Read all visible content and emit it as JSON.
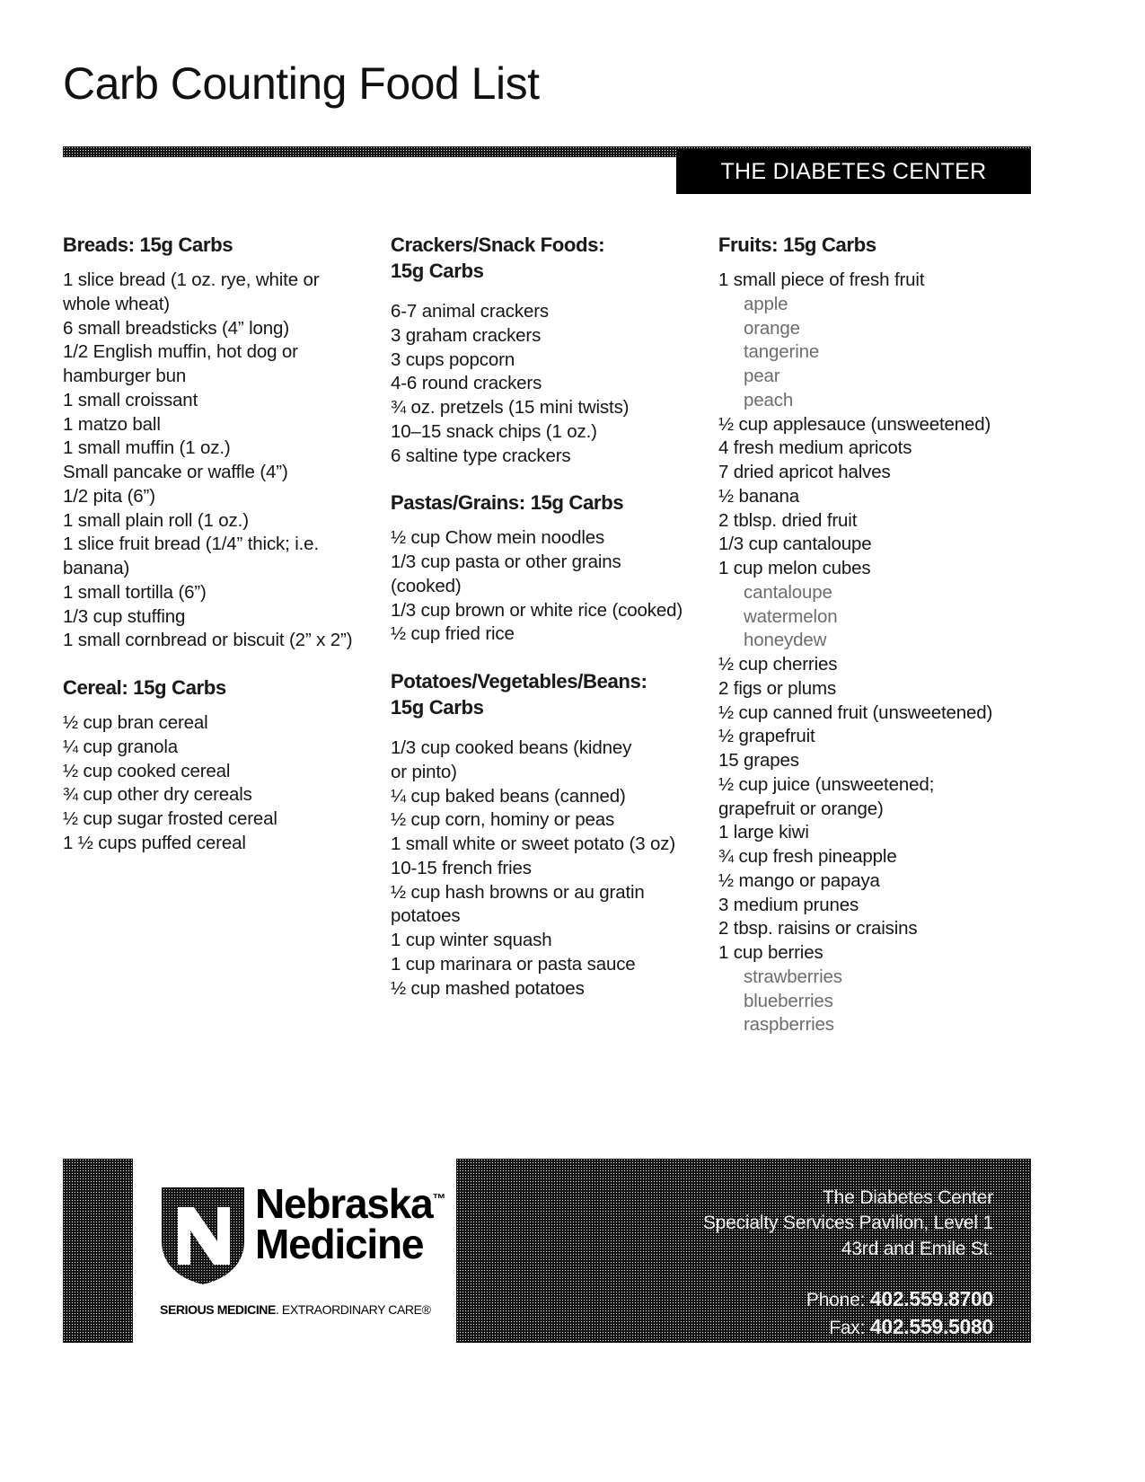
{
  "document": {
    "title": "Carb Counting Food List",
    "banner": "THE DIABETES CENTER"
  },
  "columns": [
    {
      "name": "column-1",
      "sections": [
        {
          "heading_lines": [
            "Breads: 15g Carbs"
          ],
          "items": [
            {
              "text": "1 slice bread (1 oz. rye, white or",
              "sub": false
            },
            {
              "text": "whole wheat)",
              "sub": false
            },
            {
              "text": "6 small breadsticks (4” long)",
              "sub": false
            },
            {
              "text": "1/2 English muffin, hot dog or",
              "sub": false
            },
            {
              "text": "hamburger bun",
              "sub": false
            },
            {
              "text": "1 small croissant",
              "sub": false
            },
            {
              "text": "1 matzo ball",
              "sub": false
            },
            {
              "text": "1 small muffin (1 oz.)",
              "sub": false
            },
            {
              "text": "Small pancake or waffle (4”)",
              "sub": false
            },
            {
              "text": "1/2 pita (6”)",
              "sub": false
            },
            {
              "text": "1 small plain roll (1 oz.)",
              "sub": false
            },
            {
              "text": "1 slice fruit bread (1/4” thick; i.e.",
              "sub": false
            },
            {
              "text": "banana)",
              "sub": false
            },
            {
              "text": "1 small tortilla (6”)",
              "sub": false
            },
            {
              "text": "1/3 cup stuffing",
              "sub": false
            },
            {
              "text": "1 small cornbread or biscuit (2” x 2”)",
              "sub": false
            }
          ]
        },
        {
          "heading_lines": [
            "Cereal: 15g Carbs"
          ],
          "items": [
            {
              "text": "½ cup bran cereal",
              "sub": false
            },
            {
              "text": "¼ cup granola",
              "sub": false
            },
            {
              "text": "½ cup cooked cereal",
              "sub": false
            },
            {
              "text": "¾ cup other dry cereals",
              "sub": false
            },
            {
              "text": "½ cup sugar frosted cereal",
              "sub": false
            },
            {
              "text": "1 ½ cups puffed cereal",
              "sub": false
            }
          ]
        }
      ]
    },
    {
      "name": "column-2",
      "sections": [
        {
          "heading_lines": [
            "Crackers/Snack Foods:",
            "15g Carbs"
          ],
          "items": [
            {
              "text": "6-7 animal crackers",
              "sub": false
            },
            {
              "text": "3 graham crackers",
              "sub": false
            },
            {
              "text": "3 cups popcorn",
              "sub": false
            },
            {
              "text": "4-6 round crackers",
              "sub": false
            },
            {
              "text": "¾ oz. pretzels (15 mini twists)",
              "sub": false
            },
            {
              "text": "10–15 snack chips (1 oz.)",
              "sub": false
            },
            {
              "text": "6 saltine type crackers",
              "sub": false
            }
          ]
        },
        {
          "heading_lines": [
            "Pastas/Grains: 15g Carbs"
          ],
          "items": [
            {
              "text": "½ cup Chow mein noodles",
              "sub": false
            },
            {
              "text": "1/3 cup pasta or other grains",
              "sub": false
            },
            {
              "text": "(cooked)",
              "sub": false
            },
            {
              "text": "1/3 cup brown or white rice (cooked)",
              "sub": false
            },
            {
              "text": "½ cup fried rice",
              "sub": false
            }
          ]
        },
        {
          "heading_lines": [
            "Potatoes/Vegetables/Beans:",
            "15g Carbs"
          ],
          "items": [
            {
              "text": "1/3 cup cooked beans (kidney",
              "sub": false
            },
            {
              "text": "or pinto)",
              "sub": false
            },
            {
              "text": "¼ cup baked beans (canned)",
              "sub": false
            },
            {
              "text": "½ cup corn, hominy or peas",
              "sub": false
            },
            {
              "text": "1 small white or sweet potato (3 oz)",
              "sub": false
            },
            {
              "text": "10-15 french fries",
              "sub": false
            },
            {
              "text": "½ cup hash browns or au gratin",
              "sub": false
            },
            {
              "text": "potatoes",
              "sub": false
            },
            {
              "text": "1 cup winter squash",
              "sub": false
            },
            {
              "text": "1 cup marinara or pasta sauce",
              "sub": false
            },
            {
              "text": "½ cup mashed potatoes",
              "sub": false
            }
          ]
        }
      ]
    },
    {
      "name": "column-3",
      "sections": [
        {
          "heading_lines": [
            "Fruits: 15g Carbs"
          ],
          "items": [
            {
              "text": "1 small piece of fresh fruit",
              "sub": false
            },
            {
              "text": "apple",
              "sub": true
            },
            {
              "text": "orange",
              "sub": true
            },
            {
              "text": "tangerine",
              "sub": true
            },
            {
              "text": "pear",
              "sub": true
            },
            {
              "text": "peach",
              "sub": true
            },
            {
              "text": "½ cup applesauce (unsweetened)",
              "sub": false
            },
            {
              "text": "4 fresh medium apricots",
              "sub": false
            },
            {
              "text": "7 dried apricot halves",
              "sub": false
            },
            {
              "text": "½ banana",
              "sub": false
            },
            {
              "text": "2 tblsp. dried fruit",
              "sub": false
            },
            {
              "text": "1/3 cup cantaloupe",
              "sub": false
            },
            {
              "text": "1 cup melon cubes",
              "sub": false
            },
            {
              "text": "cantaloupe",
              "sub": true
            },
            {
              "text": "watermelon",
              "sub": true
            },
            {
              "text": "honeydew",
              "sub": true
            },
            {
              "text": "½ cup cherries",
              "sub": false
            },
            {
              "text": "2 figs or plums",
              "sub": false
            },
            {
              "text": "½ cup canned fruit (unsweetened)",
              "sub": false
            },
            {
              "text": "½ grapefruit",
              "sub": false
            },
            {
              "text": "15 grapes",
              "sub": false
            },
            {
              "text": "½ cup juice (unsweetened;",
              "sub": false
            },
            {
              "text": "grapefruit or orange)",
              "sub": false
            },
            {
              "text": "1 large kiwi",
              "sub": false
            },
            {
              "text": "¾ cup fresh pineapple",
              "sub": false
            },
            {
              "text": "½ mango or papaya",
              "sub": false
            },
            {
              "text": "3 medium prunes",
              "sub": false
            },
            {
              "text": "2 tbsp. raisins or craisins",
              "sub": false
            },
            {
              "text": "1 cup berries",
              "sub": false
            },
            {
              "text": "strawberries",
              "sub": true
            },
            {
              "text": "blueberries",
              "sub": true
            },
            {
              "text": "raspberries",
              "sub": true
            }
          ]
        }
      ]
    }
  ],
  "footer": {
    "logo": {
      "wordmark_line1": "Nebraska",
      "wordmark_tm": "™",
      "wordmark_line2": "Medicine",
      "tagline_strong": "SERIOUS MEDICINE",
      "tagline_rest": ". EXTRAORDINARY CARE®"
    },
    "contact": {
      "line1": "The Diabetes Center",
      "line2": "Specialty Services Pavilion, Level 1",
      "line3": "43rd and Emile St.",
      "phone_label": "Phone: ",
      "phone_number": "402.559.8700",
      "fax_label": "Fax: ",
      "fax_number": "402.559.5080"
    }
  }
}
